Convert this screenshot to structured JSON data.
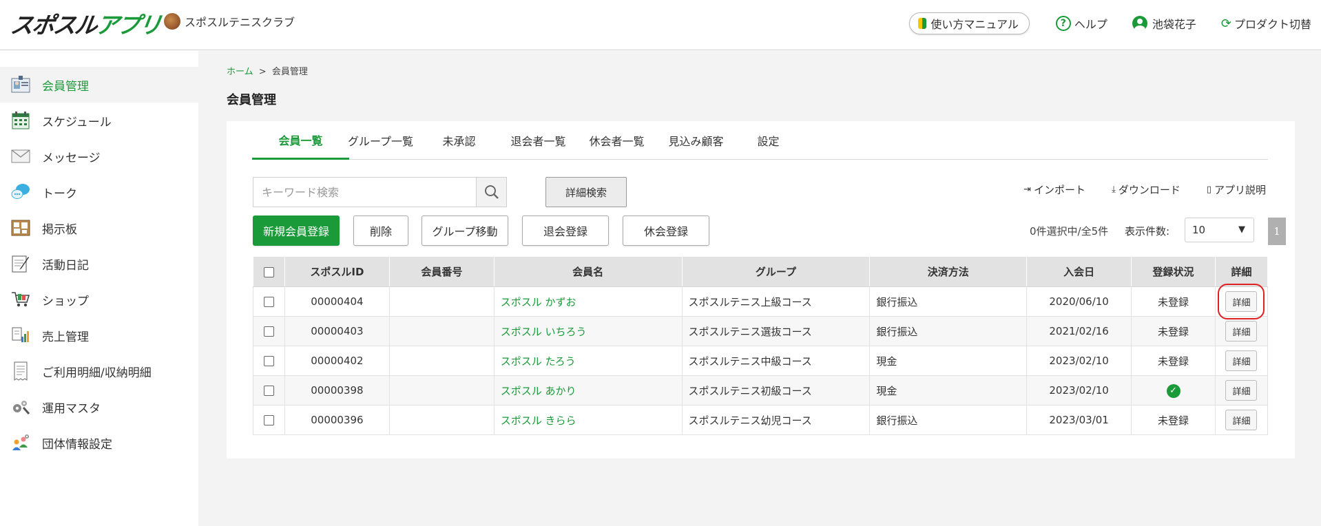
{
  "header": {
    "logo": "スポスルアプリ",
    "club_name": "スポスルテニスクラブ",
    "manual_label": "使い方マニュアル",
    "help_label": "ヘルプ",
    "user_name": "池袋花子",
    "switch_label": "プロダクト切替"
  },
  "sidebar": {
    "items": [
      {
        "label": "会員管理",
        "icon": "member-card-icon"
      },
      {
        "label": "スケジュール",
        "icon": "calendar-icon"
      },
      {
        "label": "メッセージ",
        "icon": "mail-icon"
      },
      {
        "label": "トーク",
        "icon": "chat-icon"
      },
      {
        "label": "掲示板",
        "icon": "bulletin-board-icon"
      },
      {
        "label": "活動日記",
        "icon": "diary-icon"
      },
      {
        "label": "ショップ",
        "icon": "cart-icon"
      },
      {
        "label": "売上管理",
        "icon": "sales-icon"
      },
      {
        "label": "ご利用明細/収納明細",
        "icon": "receipt-icon"
      },
      {
        "label": "運用マスタ",
        "icon": "tools-icon"
      },
      {
        "label": "団体情報設定",
        "icon": "organization-icon"
      }
    ]
  },
  "breadcrumb": {
    "home": "ホーム",
    "separator": ">",
    "current": "会員管理"
  },
  "page_title": "会員管理",
  "tabs": [
    "会員一覧",
    "グループ一覧",
    "未承認",
    "退会者一覧",
    "休会者一覧",
    "見込み顧客",
    "設定"
  ],
  "search": {
    "placeholder": "キーワード検索",
    "advanced_label": "詳細検索"
  },
  "utility_links": {
    "import": "インポート",
    "download": "ダウンロード",
    "app_help": "アプリ説明"
  },
  "actions": {
    "register": "新規会員登録",
    "delete": "削除",
    "move_group": "グループ移動",
    "withdraw": "退会登録",
    "suspend": "休会登録"
  },
  "list_status": {
    "count_text": "0件選択中/全5件",
    "per_page_label": "表示件数:",
    "per_page_value": "10",
    "current_page": "1"
  },
  "table": {
    "headers": [
      "スポスルID",
      "会員番号",
      "会員名",
      "グループ",
      "決済方法",
      "入会日",
      "登録状況",
      "詳細"
    ],
    "rows": [
      {
        "id": "00000404",
        "member_no": "",
        "name": "スポスル かずお",
        "group": "スポスルテニス上級コース",
        "payment": "銀行振込",
        "joined": "2020/06/10",
        "status": "未登録",
        "detail": "詳細"
      },
      {
        "id": "00000403",
        "member_no": "",
        "name": "スポスル いちろう",
        "group": "スポスルテニス選抜コース",
        "payment": "銀行振込",
        "joined": "2021/02/16",
        "status": "未登録",
        "detail": "詳細"
      },
      {
        "id": "00000402",
        "member_no": "",
        "name": "スポスル たろう",
        "group": "スポスルテニス中級コース",
        "payment": "現金",
        "joined": "2023/02/10",
        "status": "未登録",
        "detail": "詳細"
      },
      {
        "id": "00000398",
        "member_no": "",
        "name": "スポスル あかり",
        "group": "スポスルテニス初級コース",
        "payment": "現金",
        "joined": "2023/02/10",
        "status": "",
        "detail": "詳細"
      },
      {
        "id": "00000396",
        "member_no": "",
        "name": "スポスル きらら",
        "group": "スポスルテニス幼児コース",
        "payment": "銀行振込",
        "joined": "2023/03/01",
        "status": "未登録",
        "detail": "詳細"
      }
    ]
  },
  "colors": {
    "accent": "#1a9a39",
    "highlight": "#e02020"
  }
}
